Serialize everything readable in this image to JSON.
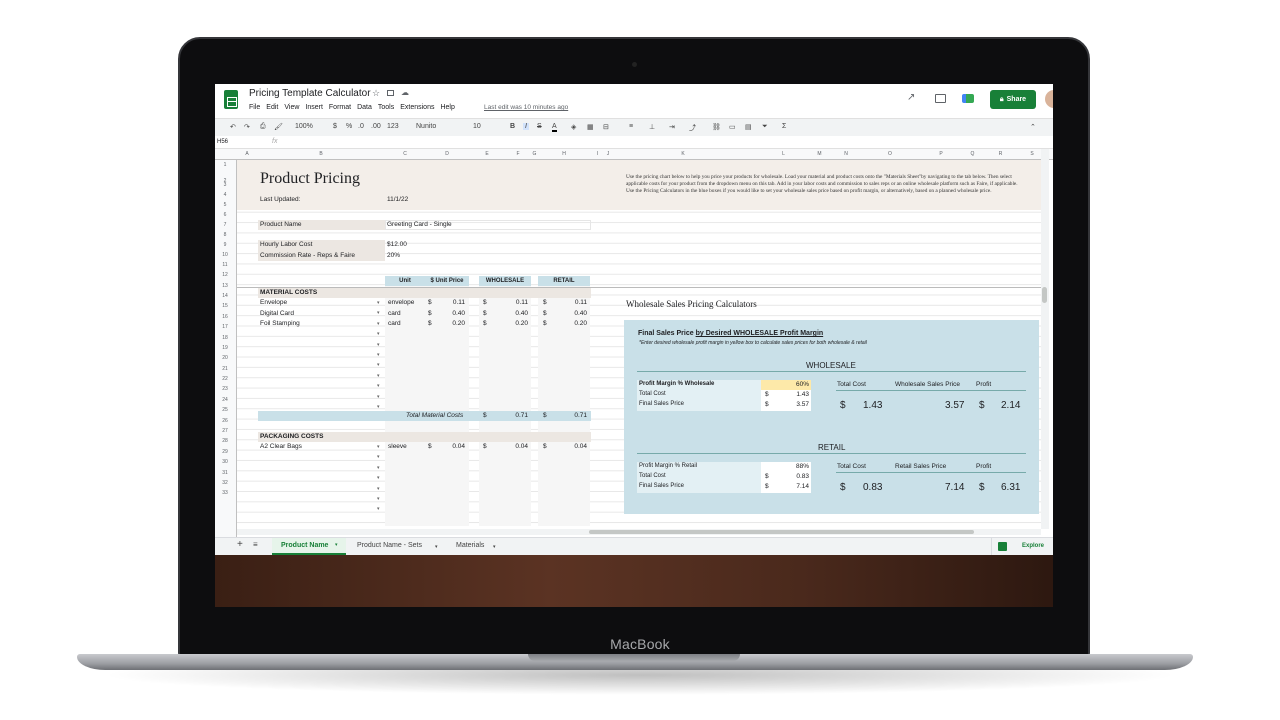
{
  "device": {
    "brand": "MacBook"
  },
  "doc": {
    "title": "Pricing Template Calculator",
    "last_edit": "Last edit was 10 minutes ago",
    "share_label": "Share"
  },
  "menu": [
    "File",
    "Edit",
    "View",
    "Insert",
    "Format",
    "Data",
    "Tools",
    "Extensions",
    "Help"
  ],
  "toolbar": {
    "zoom": "100%",
    "currency": "$",
    "percent": "%",
    "decimals_less": ".0",
    "decimals_more": ".00",
    "format_more": "123",
    "font": "Nunito",
    "size": "10",
    "bold": "B",
    "italic": "I",
    "strike": "S",
    "textcolor": "A"
  },
  "formula": {
    "cell_ref": "H56",
    "fx": "fx"
  },
  "columns": [
    "A",
    "B",
    "C",
    "D",
    "E",
    "F",
    "G",
    "H",
    "I",
    "J",
    "K",
    "L",
    "M",
    "N",
    "O",
    "P",
    "Q",
    "R",
    "S"
  ],
  "rows": [
    "1",
    "2",
    "3",
    "4",
    "5",
    "6",
    "7",
    "8",
    "9",
    "10",
    "11",
    "12",
    "13",
    "14",
    "15",
    "16",
    "17",
    "18",
    "19",
    "20",
    "21",
    "22",
    "23",
    "24",
    "25",
    "26",
    "27",
    "28",
    "29",
    "30",
    "31",
    "32",
    "33"
  ],
  "sheet": {
    "title": "Product Pricing",
    "last_updated_label": "Last Updated:",
    "last_updated": "11/1/22",
    "product_name_label": "Product Name",
    "product_name": "Greeting Card - Single",
    "hourly_label": "Hourly Labor Cost",
    "hourly": "$12.00",
    "commission_label": "Commission Rate - Reps & Faire",
    "commission": "20%",
    "intro": "Use the pricing chart below to help you price your products for wholesale. Load your material and product costs onto the \"Materials Sheet\"by navigating to the tab below. Then select applicable costs for your product from the dropdown menu on this tab. Add in your labor costs and commission to sales reps or an online wholesale platform such as Faire, if applicable. Use the Pricing Calculators in the blue boxes if you would like to set your wholesale sales price based on profit margin, or alternatively, based on a planned wholesale price.",
    "hdr_unit": "Unit",
    "hdr_unit_price": "$ Unit Price",
    "hdr_wholesale": "WHOLESALE",
    "hdr_retail": "RETAIL",
    "material_costs": "MATERIAL COSTS",
    "materials": [
      {
        "name": "Envelope",
        "unit": "envelope",
        "cur": "$",
        "price": "0.11",
        "wcur": "$",
        "wholesale": "0.11",
        "rcur": "$",
        "retail": "0.11"
      },
      {
        "name": "Digital Card",
        "unit": "card",
        "cur": "$",
        "price": "0.40",
        "wcur": "$",
        "wholesale": "0.40",
        "rcur": "$",
        "retail": "0.40"
      },
      {
        "name": "Foil Stamping",
        "unit": "card",
        "cur": "$",
        "price": "0.20",
        "wcur": "$",
        "wholesale": "0.20",
        "rcur": "$",
        "retail": "0.20"
      }
    ],
    "total_material_label": "Total Material Costs",
    "total_material_cur": "$",
    "total_material_w": "0.71",
    "total_material_rcur": "$",
    "total_material_r": "0.71",
    "packaging_costs": "PACKAGING COSTS",
    "packaging": [
      {
        "name": "A2 Clear Bags",
        "unit": "sleeve",
        "cur": "$",
        "price": "0.04",
        "wcur": "$",
        "wholesale": "0.04",
        "rcur": "$",
        "retail": "0.04"
      }
    ]
  },
  "calc": {
    "section_title": "Wholesale Sales Pricing Calculators",
    "heading_a": "Final Sales Price ",
    "heading_b": "by Desired WHOLESALE Profit Margin",
    "note": "*Enter desired wholesale profit margin in yellow box to calculate sales prices for both wholesale & retail",
    "wholesale_label": "WHOLESALE",
    "retail_label": "RETAIL",
    "w_margin_label": "Profit Margin % Wholesale",
    "w_margin": "60%",
    "w_total_cost_label": "Total Cost",
    "w_cur1": "$",
    "w_total_cost": "1.43",
    "w_final_label": "Final Sales Price",
    "w_cur2": "$",
    "w_final": "3.57",
    "w_h_cost": "Total Cost",
    "w_h_price": "Wholesale Sales Price",
    "w_h_profit": "Profit",
    "w_big_cur": "$",
    "w_big_cost": "1.43",
    "w_big_price": "3.57",
    "w_big_cur2": "$",
    "w_big_profit": "2.14",
    "r_margin_label": "Profit Margin % Retail",
    "r_margin": "88%",
    "r_total_cost_label": "Total Cost",
    "r_cur1": "$",
    "r_total_cost": "0.83",
    "r_final_label": "Final Sales Price",
    "r_cur2": "$",
    "r_final": "7.14",
    "r_h_cost": "Total Cost",
    "r_h_price": "Retail Sales Price",
    "r_h_profit": "Profit",
    "r_big_cur": "$",
    "r_big_cost": "0.83",
    "r_big_price": "7.14",
    "r_big_cur2": "$",
    "r_big_profit": "6.31"
  },
  "tabs": [
    {
      "label": "Product Name"
    },
    {
      "label": "Product Name - Sets"
    },
    {
      "label": "Materials"
    }
  ],
  "explore_label": "Explore",
  "colors": {
    "green": "#188038",
    "blue": "#c9e0e8",
    "tan": "#f3eee9",
    "yellow": "#fde9a9"
  }
}
